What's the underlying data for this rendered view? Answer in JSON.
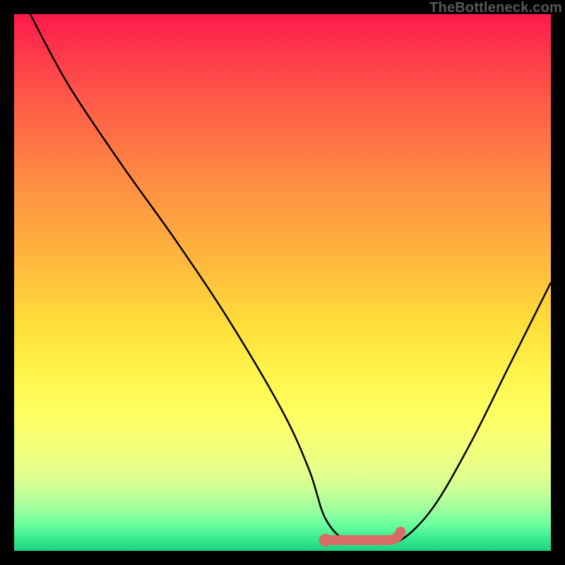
{
  "watermark": "TheBottleneck.com",
  "chart_data": {
    "type": "line",
    "title": "",
    "xlabel": "",
    "ylabel": "",
    "xlim": [
      0,
      100
    ],
    "ylim": [
      0,
      100
    ],
    "grid": false,
    "legend": false,
    "background": "vertical-gradient red→orange→yellow→green",
    "series": [
      {
        "name": "curve",
        "color": "#000000",
        "x": [
          3,
          10,
          20,
          30,
          40,
          50,
          55,
          58,
          62,
          68,
          72,
          78,
          85,
          92,
          100
        ],
        "y": [
          100,
          87,
          72,
          58,
          43,
          26,
          15,
          6,
          2,
          2,
          2,
          8,
          20,
          34,
          50
        ]
      }
    ],
    "flat_region": {
      "color": "#d96a68",
      "x_start": 58,
      "x_end": 72,
      "y": 2,
      "note": "optimal / no-bottleneck zone highlighted at valley floor"
    }
  }
}
